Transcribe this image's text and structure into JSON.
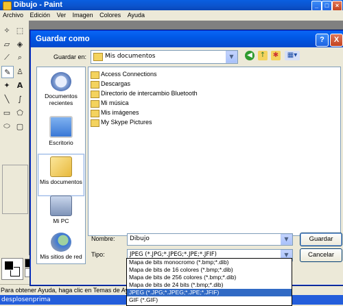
{
  "paint": {
    "title": "Dibujo - Paint",
    "menu": [
      "Archivo",
      "Edición",
      "Ver",
      "Imagen",
      "Colores",
      "Ayuda"
    ],
    "status_text": "Para obtener Ayuda, haga clic en Temas de Ayuda",
    "taskbar_item": "desplosenprima",
    "palette_colors": [
      "#000000",
      "#808080",
      "#800000",
      "#808000",
      "#008000",
      "#008080",
      "#000080",
      "#800080",
      "#808040",
      "#004040",
      "#0080ff",
      "#004080",
      "#8000ff",
      "#804000",
      "#ffffff",
      "#c0c0c0",
      "#ff0000",
      "#ffff00",
      "#00ff00",
      "#00ffff",
      "#0000ff",
      "#ff00ff",
      "#ffff80",
      "#00ff80",
      "#80ffff",
      "#8080ff",
      "#ff0080",
      "#ff8040"
    ]
  },
  "dialog": {
    "title": "Guardar como",
    "help_label": "?",
    "close_label": "X",
    "save_in_label": "Guardar en:",
    "save_in_value": "Mis documentos",
    "places": [
      {
        "label": "Documentos recientes",
        "icon": "recent-documents-icon"
      },
      {
        "label": "Escritorio",
        "icon": "desktop-icon"
      },
      {
        "label": "Mis documentos",
        "icon": "my-documents-icon"
      },
      {
        "label": "Mi PC",
        "icon": "my-computer-icon"
      },
      {
        "label": "Mis sitios de red",
        "icon": "network-places-icon"
      }
    ],
    "files": [
      "Access Connections",
      "Descargas",
      "Directorio de intercambio Bluetooth",
      "Mi música",
      "Mis imágenes",
      "My Skype Pictures"
    ],
    "name_label": "Nombre:",
    "name_value": "Dibujo",
    "type_label": "Tipo:",
    "type_value": "JPEG (*.JPG;*.JPEG;*.JPE;*.JFIF)",
    "save_button": "Guardar",
    "cancel_button": "Cancelar",
    "type_options": [
      "Mapa de bits monocromo (*.bmp;*.dib)",
      "Mapa de bits de 16 colores (*.bmp;*.dib)",
      "Mapa de bits de 256 colores (*.bmp;*.dib)",
      "Mapa de bits de 24 bits (*.bmp;*.dib)",
      "JPEG (*.JPG;*.JPEG;*.JPE;*.JFIF)",
      "GIF (*.GIF)"
    ],
    "type_selected_index": 4
  }
}
